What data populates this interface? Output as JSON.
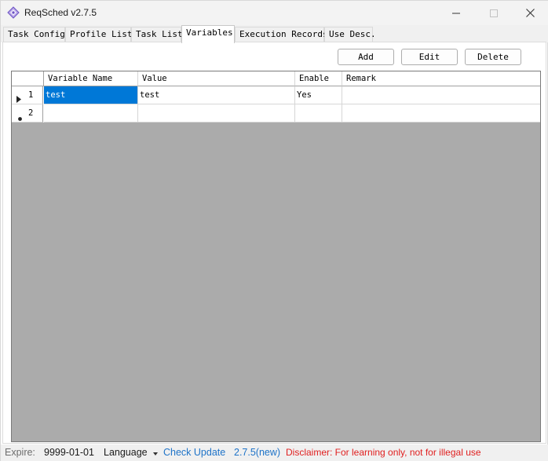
{
  "window": {
    "title": "ReqSched v2.7.5",
    "icon": "app-diamond-icon",
    "controls": [
      "minimize-icon",
      "maximize-icon",
      "close-icon"
    ]
  },
  "tabs": [
    {
      "label": "Task Config",
      "active": false
    },
    {
      "label": "Profile List",
      "active": false
    },
    {
      "label": "Task List",
      "active": false
    },
    {
      "label": "Variables",
      "active": true
    },
    {
      "label": "Execution Records",
      "active": false
    },
    {
      "label": "Use Desc.",
      "active": false
    }
  ],
  "toolbar": {
    "add_label": "Add",
    "edit_label": "Edit",
    "delete_label": "Delete"
  },
  "grid": {
    "columns": [
      "Variable Name",
      "Value",
      "Enable",
      "Remark"
    ],
    "rows": [
      {
        "index": "1",
        "marker": "current-row-arrow-icon",
        "cells": [
          "test",
          "test",
          "Yes",
          ""
        ],
        "selected_column": 0
      },
      {
        "index": "2",
        "marker": "new-row-star-icon",
        "cells": [
          "",
          "",
          "",
          ""
        ]
      }
    ]
  },
  "status": {
    "expire_label": "Expire:",
    "expire_value": "9999-01-01",
    "language_label": "Language",
    "check_update": "Check Update",
    "version_new": "2.7.5(new)",
    "disclaimer": "Disclaimer: For learning only, not for illegal use"
  },
  "colors": {
    "selection": "#0078d7",
    "link": "#1e73c8",
    "warning": "#e02020",
    "grid_background": "#ababab"
  }
}
